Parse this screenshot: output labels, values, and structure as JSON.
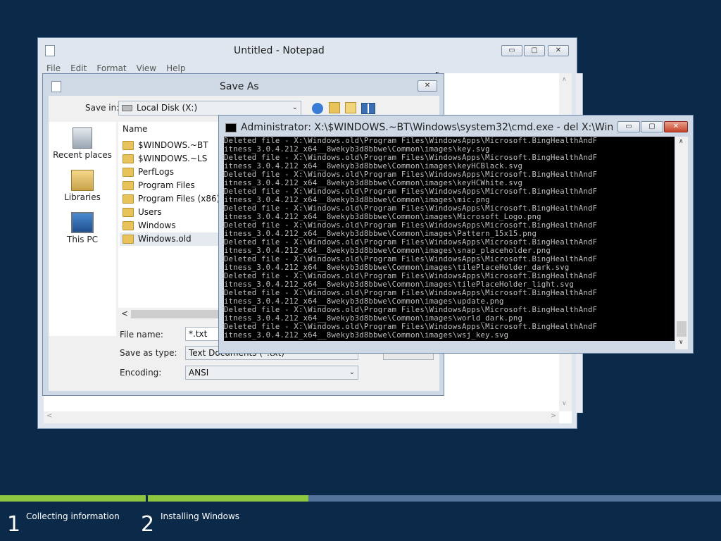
{
  "notepad": {
    "title": "Untitled - Notepad",
    "menu": [
      "File",
      "Edit",
      "Format",
      "View",
      "Help"
    ],
    "buttons": {
      "minimize": "▭",
      "maximize": "▢",
      "close": "✕"
    }
  },
  "save_as": {
    "title": "Save As",
    "save_in_label": "Save in:",
    "save_in_value": "Local Disk (X:)",
    "column_name": "Name",
    "sidebar": [
      {
        "label": "Recent places",
        "icon": "recent-places-icon"
      },
      {
        "label": "Libraries",
        "icon": "libraries-icon"
      },
      {
        "label": "This PC",
        "icon": "this-pc-icon"
      }
    ],
    "folders": [
      "$WINDOWS.~BT",
      "$WINDOWS.~LS",
      "PerfLogs",
      "Program Files",
      "Program Files (x86)",
      "Users",
      "Windows",
      "Windows.old"
    ],
    "selected_folder": "Windows.old",
    "file_name_label": "File name:",
    "file_name_value": "*.txt",
    "save_as_type_label": "Save as type:",
    "save_as_type_value": "Text Documents (*.txt)",
    "encoding_label": "Encoding:",
    "encoding_value": "ANSI",
    "close": "✕"
  },
  "cmd": {
    "title": "Administrator: X:\\$WINDOWS.~BT\\Windows\\system32\\cmd.exe - del  X:\\Wind...",
    "lines": [
      "Deleted file - X:\\Windows.old\\Program Files\\WindowsApps\\Microsoft.BingHealthAndF",
      "itness_3.0.4.212_x64__8wekyb3d8bbwe\\Common\\images\\key.svg",
      "Deleted file - X:\\Windows.old\\Program Files\\WindowsApps\\Microsoft.BingHealthAndF",
      "itness_3.0.4.212_x64__8wekyb3d8bbwe\\Common\\images\\keyHCBlack.svg",
      "Deleted file - X:\\Windows.old\\Program Files\\WindowsApps\\Microsoft.BingHealthAndF",
      "itness_3.0.4.212_x64__8wekyb3d8bbwe\\Common\\images\\keyHCWhite.svg",
      "Deleted file - X:\\Windows.old\\Program Files\\WindowsApps\\Microsoft.BingHealthAndF",
      "itness_3.0.4.212_x64__8wekyb3d8bbwe\\Common\\images\\mic.png",
      "Deleted file - X:\\Windows.old\\Program Files\\WindowsApps\\Microsoft.BingHealthAndF",
      "itness_3.0.4.212_x64__8wekyb3d8bbwe\\Common\\images\\Microsoft_Logo.png",
      "Deleted file - X:\\Windows.old\\Program Files\\WindowsApps\\Microsoft.BingHealthAndF",
      "itness_3.0.4.212_x64__8wekyb3d8bbwe\\Common\\images\\Pattern_15x15.png",
      "Deleted file - X:\\Windows.old\\Program Files\\WindowsApps\\Microsoft.BingHealthAndF",
      "itness_3.0.4.212_x64__8wekyb3d8bbwe\\Common\\images\\snap_placeholder.png",
      "Deleted file - X:\\Windows.old\\Program Files\\WindowsApps\\Microsoft.BingHealthAndF",
      "itness_3.0.4.212_x64__8wekyb3d8bbwe\\Common\\images\\tilePlaceHolder_dark.svg",
      "Deleted file - X:\\Windows.old\\Program Files\\WindowsApps\\Microsoft.BingHealthAndF",
      "itness_3.0.4.212_x64__8wekyb3d8bbwe\\Common\\images\\tilePlaceHolder_light.svg",
      "Deleted file - X:\\Windows.old\\Program Files\\WindowsApps\\Microsoft.BingHealthAndF",
      "itness_3.0.4.212_x64__8wekyb3d8bbwe\\Common\\images\\update.png",
      "Deleted file - X:\\Windows.old\\Program Files\\WindowsApps\\Microsoft.BingHealthAndF",
      "itness_3.0.4.212_x64__8wekyb3d8bbwe\\Common\\images\\world_dark.png",
      "Deleted file - X:\\Windows.old\\Program Files\\WindowsApps\\Microsoft.BingHealthAndF",
      "itness_3.0.4.212_x64__8wekyb3d8bbwe\\Common\\images\\wsj_key.svg"
    ],
    "scroll_up": "∧",
    "scroll_down": "∨"
  },
  "setup": {
    "step1_number": "1",
    "step1_label": "Collecting information",
    "step1_progress": 1.0,
    "step2_number": "2",
    "step2_label": "Installing Windows",
    "step2_progress": 0.28
  },
  "colors": {
    "desktop": "#0b2a4a",
    "progress_fill": "#8dc63f",
    "progress_track": "#54739a"
  }
}
